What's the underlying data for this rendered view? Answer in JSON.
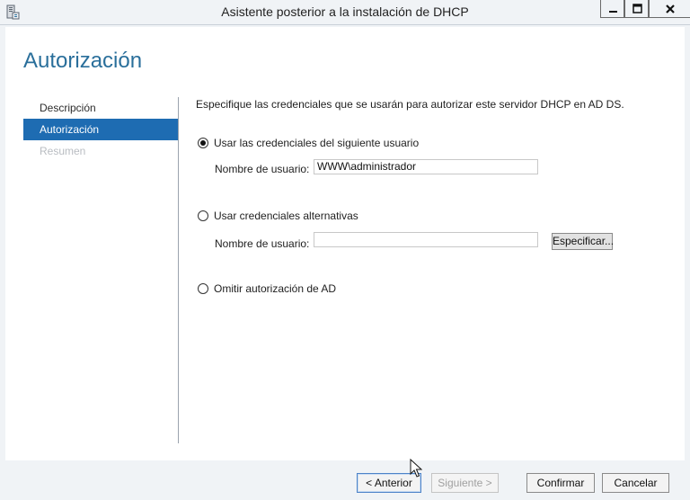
{
  "window": {
    "title": "Asistente posterior a la instalación de DHCP"
  },
  "page": {
    "title": "Autorización"
  },
  "nav": {
    "items": [
      {
        "label": "Descripción",
        "state": "normal"
      },
      {
        "label": "Autorización",
        "state": "active"
      },
      {
        "label": "Resumen",
        "state": "disabled"
      }
    ]
  },
  "content": {
    "intro": "Especifique las credenciales que se usarán para autorizar este servidor DHCP en AD DS.",
    "option_current": {
      "label": "Usar las credenciales del siguiente usuario",
      "selected": true,
      "username_label": "Nombre de usuario:",
      "username_value": "WWW\\administrador"
    },
    "option_alternate": {
      "label": "Usar credenciales alternativas",
      "selected": false,
      "username_label": "Nombre de usuario:",
      "username_value": "",
      "specify_button": "Especificar..."
    },
    "option_skip": {
      "label": "Omitir autorización de AD",
      "selected": false
    }
  },
  "buttons": {
    "previous": "< Anterior",
    "next": "Siguiente >",
    "confirm": "Confirmar",
    "cancel": "Cancelar"
  },
  "colors": {
    "accent": "#1e6cb2",
    "title": "#2a6f9b"
  }
}
